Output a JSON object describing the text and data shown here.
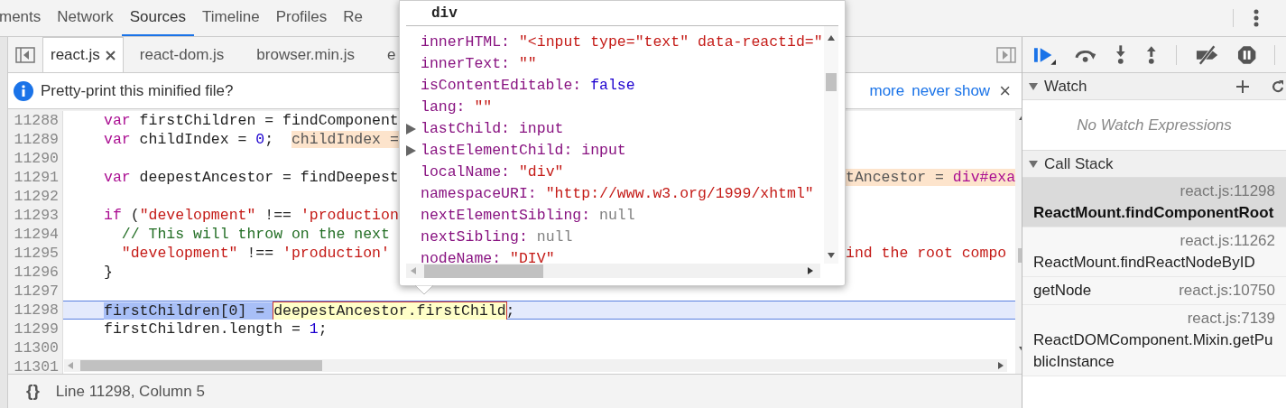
{
  "panel_tabs": [
    {
      "label": "ments",
      "selected": false
    },
    {
      "label": "Network",
      "selected": false
    },
    {
      "label": "Sources",
      "selected": true
    },
    {
      "label": "Timeline",
      "selected": false
    },
    {
      "label": "Profiles",
      "selected": false
    },
    {
      "label": "Re",
      "selected": false
    }
  ],
  "file_tabs": [
    {
      "label": "react.js",
      "selected": true,
      "closable": true
    },
    {
      "label": "react-dom.js",
      "selected": false,
      "closable": false
    },
    {
      "label": "browser.min.js",
      "selected": false,
      "closable": false
    },
    {
      "label": "e",
      "selected": false,
      "closable": false
    }
  ],
  "infobar": {
    "message": "Pretty-print this minified file?",
    "links": [
      "more",
      "never show"
    ],
    "close": "×"
  },
  "code_lines": [
    {
      "number": "11288",
      "current": false,
      "left": [
        {
          "kind": "keyword",
          "text": "var "
        },
        {
          "kind": "plain",
          "text": "firstChildren = findComponent"
        }
      ]
    },
    {
      "number": "11289",
      "current": false,
      "left": [
        {
          "kind": "keyword",
          "text": "var "
        },
        {
          "kind": "plain",
          "text": "childIndex = "
        },
        {
          "kind": "number",
          "text": "0"
        },
        {
          "kind": "plain",
          "text": ";  "
        },
        {
          "kind": "value",
          "text": "childIndex ="
        }
      ]
    },
    {
      "number": "11290",
      "current": false
    },
    {
      "number": "11291",
      "current": false,
      "left": [
        {
          "kind": "keyword",
          "text": "var "
        },
        {
          "kind": "plain",
          "text": "deepestAncestor = findDeepest"
        }
      ],
      "right": [
        {
          "kind": "value",
          "text": "tAncestor = "
        },
        {
          "kind": "value-node",
          "text": "div#exa"
        }
      ]
    },
    {
      "number": "11292",
      "current": false
    },
    {
      "number": "11293",
      "current": false,
      "left": [
        {
          "kind": "keyword",
          "text": "if "
        },
        {
          "kind": "plain",
          "text": "("
        },
        {
          "kind": "string",
          "text": "\"development\""
        },
        {
          "kind": "plain",
          "text": " !== "
        },
        {
          "kind": "string",
          "text": "'production"
        }
      ]
    },
    {
      "number": "11294",
      "current": false,
      "left": [
        {
          "kind": "comment",
          "text": "  // This will throw on the next"
        }
      ]
    },
    {
      "number": "11295",
      "current": false,
      "left": [
        {
          "kind": "string",
          "text": "  \"development\""
        },
        {
          "kind": "plain",
          "text": " !== "
        },
        {
          "kind": "string",
          "text": "'production'"
        }
      ],
      "right": [
        {
          "kind": "string",
          "text": "ind the root compo"
        }
      ]
    },
    {
      "number": "11296",
      "current": false,
      "left": [
        {
          "kind": "plain",
          "text": "}"
        }
      ]
    },
    {
      "number": "11297",
      "current": false
    },
    {
      "number": "11298",
      "current": true,
      "left": [
        {
          "kind": "selected",
          "text": "firstChildren[0] = "
        },
        {
          "kind": "hovered",
          "text": "deepestAncestor.firstChild"
        },
        {
          "kind": "plain",
          "text": ";"
        }
      ]
    },
    {
      "number": "11299",
      "current": false,
      "left": [
        {
          "kind": "plain",
          "text": "firstChildren.length = "
        },
        {
          "kind": "number",
          "text": "1"
        },
        {
          "kind": "plain",
          "text": ";"
        }
      ]
    },
    {
      "number": "11300",
      "current": false
    },
    {
      "number": "11301",
      "current": false
    }
  ],
  "status_bar": {
    "format_button": "{}",
    "position": "Line 11298, Column 5"
  },
  "popover": {
    "title": "div",
    "properties": [
      {
        "expandable": false,
        "name": "innerHTML:",
        "kind": "string",
        "value": "\"<input type=\"text\" data-reactid=\""
      },
      {
        "expandable": false,
        "name": "innerText:",
        "kind": "string",
        "value": "\"\""
      },
      {
        "expandable": false,
        "name": "isContentEditable:",
        "kind": "boolean",
        "value": "false"
      },
      {
        "expandable": false,
        "name": "lang:",
        "kind": "string",
        "value": "\"\""
      },
      {
        "expandable": true,
        "name": "lastChild:",
        "kind": "node",
        "value": "input"
      },
      {
        "expandable": true,
        "name": "lastElementChild:",
        "kind": "node",
        "value": "input"
      },
      {
        "expandable": false,
        "name": "localName:",
        "kind": "string",
        "value": "\"div\""
      },
      {
        "expandable": false,
        "name": "namespaceURI:",
        "kind": "string",
        "value": "\"http://www.w3.org/1999/xhtml\""
      },
      {
        "expandable": false,
        "name": "nextElementSibling:",
        "kind": "null",
        "value": "null"
      },
      {
        "expandable": false,
        "name": "nextSibling:",
        "kind": "null",
        "value": "null"
      },
      {
        "expandable": false,
        "name": "nodeName:",
        "kind": "string",
        "value": "\"DIV\""
      }
    ]
  },
  "watch": {
    "title": "Watch",
    "expanded": true,
    "empty_message": "No Watch Expressions"
  },
  "call_stack": {
    "title": "Call Stack",
    "expanded": true,
    "frames": [
      {
        "name": "ReactMount.findComponentRoot",
        "location": "react.js:11298",
        "selected": true
      },
      {
        "name": "ReactMount.findReactNodeByID",
        "location": "react.js:11262",
        "selected": false
      },
      {
        "name": "getNode",
        "location": "react.js:10750",
        "selected": false
      },
      {
        "name": "ReactDOMComponent.Mixin.getPublicInstance",
        "location": "react.js:7139",
        "selected": false
      }
    ]
  }
}
